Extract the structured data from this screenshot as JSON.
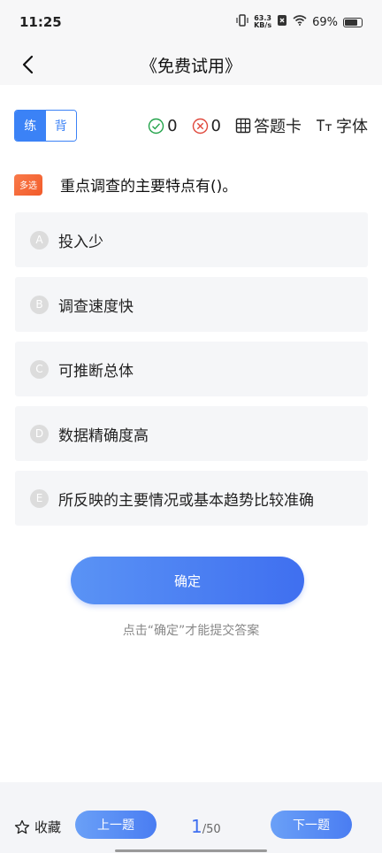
{
  "status": {
    "time": "11:25",
    "speed_top": "63.3",
    "speed_bottom": "KB/s",
    "battery": "69%"
  },
  "header": {
    "title": "《免费试用》"
  },
  "toolbar": {
    "mode_practice": "练",
    "mode_recite": "背",
    "correct_count": "0",
    "wrong_count": "0",
    "answer_card": "答题卡",
    "font_label": "字体"
  },
  "question": {
    "tag": "多选",
    "text": "重点调查的主要特点有()。",
    "options": [
      {
        "letter": "A",
        "text": "投入少"
      },
      {
        "letter": "B",
        "text": "调查速度快"
      },
      {
        "letter": "C",
        "text": "可推断总体"
      },
      {
        "letter": "D",
        "text": "数据精确度高"
      },
      {
        "letter": "E",
        "text": "所反映的主要情况或基本趋势比较准确"
      }
    ]
  },
  "actions": {
    "confirm": "确定",
    "hint": "点击“确定”才能提交答案"
  },
  "footer": {
    "favorite": "收藏",
    "prev": "上一题",
    "next": "下一题",
    "current_page": "1",
    "total_pages": "/50"
  },
  "colors": {
    "accent": "#3f6ff0",
    "tag": "#f25b2a"
  }
}
